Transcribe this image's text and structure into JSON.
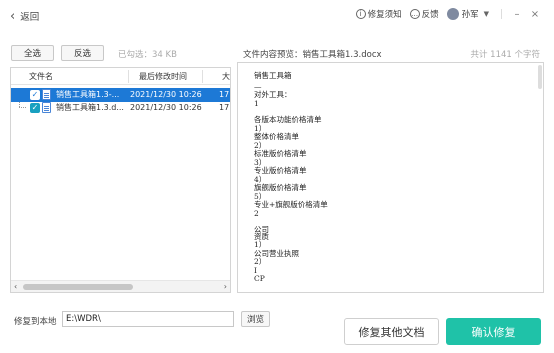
{
  "titlebar": {
    "back_label": "返回",
    "repair_notice": "修复须知",
    "feedback": "反馈",
    "user_name": "孙军",
    "minimize": "–",
    "close": "×"
  },
  "toolbar": {
    "select_all": "全选",
    "invert": "反选",
    "selected_info": "已勾选：34 KB",
    "preview_title": "文件内容预览：销售工具箱1.3.docx",
    "char_count": "共计 1141 个字符"
  },
  "file_list": {
    "columns": [
      "文件名",
      "最后修改时间",
      "大"
    ],
    "rows": [
      {
        "name": "销售工具箱1.3-...",
        "modified": "2021/12/30 10:26",
        "size": "17",
        "selected": true
      },
      {
        "name": "销售工具箱1.3.d...",
        "modified": "2021/12/30 10:26",
        "size": "17",
        "selected": false
      }
    ]
  },
  "preview_lines": [
    "销售工具箱",
    "—",
    "对外工具：",
    "1",
    "",
    "各版本功能价格清单",
    "1）",
    "整体价格清单",
    "2）",
    "标准版价格清单",
    "3）",
    "专业版价格清单",
    "4）",
    "旗舰版价格清单",
    "5）",
    "专业+旗舰版价格清单",
    "2",
    "",
    "公司",
    "资质",
    "1）",
    "公司营业执照",
    "2）",
    "I",
    "CP"
  ],
  "bottom": {
    "restore_label": "修复到本地",
    "path_value": "E:\\WDR\\",
    "browse": "浏览",
    "other_docs": "修复其他文档",
    "confirm": "确认修复"
  },
  "colors": {
    "accent": "#1fc2a8",
    "selection": "#1d79d6",
    "checkbox": "#19a0c0"
  }
}
